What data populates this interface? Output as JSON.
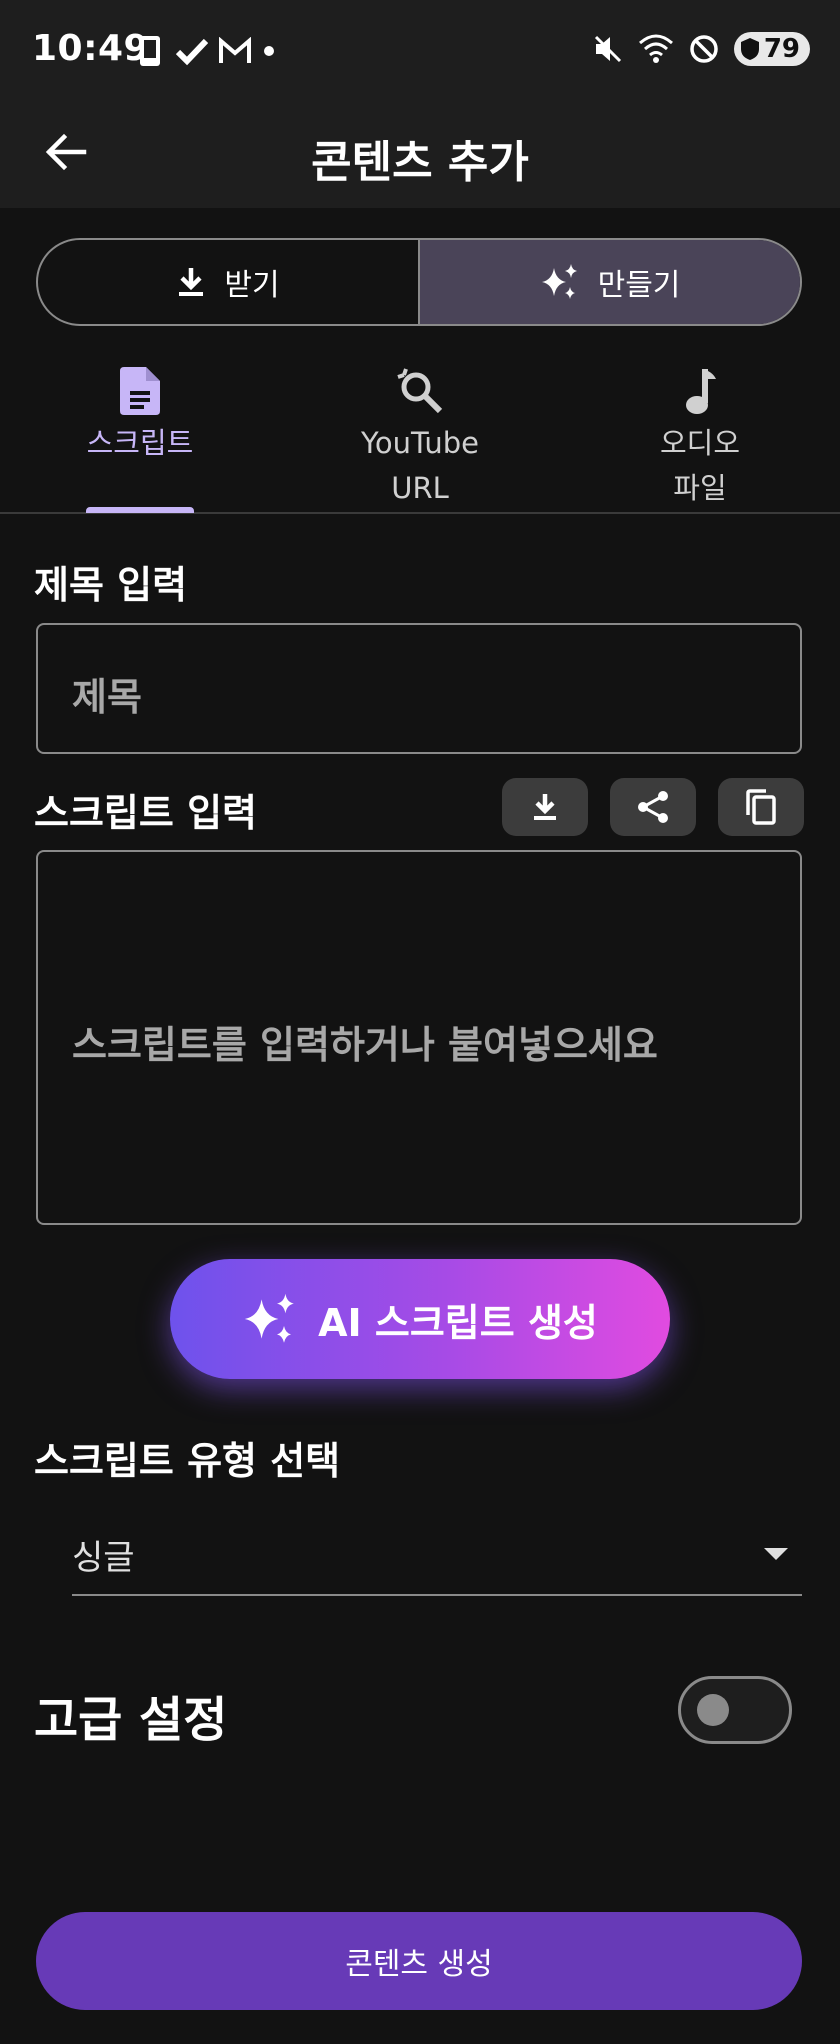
{
  "status_bar": {
    "time": "10:49",
    "left_icons": [
      "phone-icon",
      "check-icon",
      "gmail-icon",
      "dot-icon"
    ],
    "right_icons": [
      "mute-icon",
      "wifi-icon",
      "dnd-icon"
    ],
    "battery": "79"
  },
  "app_bar": {
    "title": "콘텐츠 추가"
  },
  "segmented": {
    "receive_label": "받기",
    "create_label": "만들기",
    "active": "create"
  },
  "tabs": [
    {
      "label": "스크립트",
      "icon": "document-icon",
      "active": true
    },
    {
      "label_line1": "YouTube",
      "label_line2": "URL",
      "icon": "search-refresh-icon",
      "active": false
    },
    {
      "label_line1": "오디오",
      "label_line2": "파일",
      "icon": "music-note-icon",
      "active": false
    }
  ],
  "title_section": {
    "label": "제목 입력",
    "placeholder": "제목"
  },
  "script_section": {
    "label": "스크립트 입력",
    "placeholder": "스크립트를 입력하거나 붙여넣으세요"
  },
  "ai_button": {
    "label": "AI 스크립트 생성"
  },
  "script_type": {
    "label": "스크립트 유형 선택",
    "selected": "싱글"
  },
  "advanced": {
    "label": "고급 설정",
    "enabled": false
  },
  "submit": {
    "label": "콘텐츠 생성"
  },
  "colors": {
    "accent": "#c7b6f7",
    "primary": "#673ab7",
    "gradient_start": "#6e52ec",
    "gradient_end": "#e14be0"
  }
}
